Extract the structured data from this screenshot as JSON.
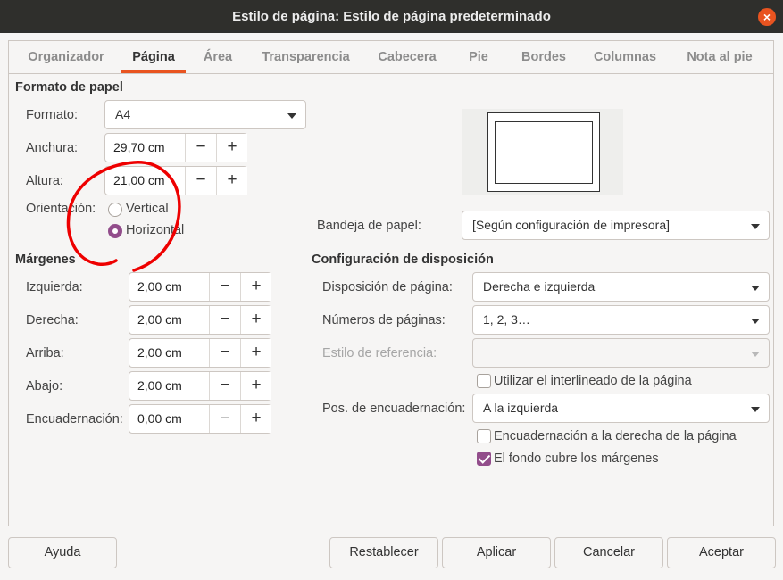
{
  "window": {
    "title": "Estilo de página: Estilo de página predeterminado",
    "close_icon": "×"
  },
  "tabs": [
    {
      "label": "Organizador"
    },
    {
      "label": "Página"
    },
    {
      "label": "Área"
    },
    {
      "label": "Transparencia"
    },
    {
      "label": "Cabecera"
    },
    {
      "label": "Pie"
    },
    {
      "label": "Bordes"
    },
    {
      "label": "Columnas"
    },
    {
      "label": "Nota al pie"
    }
  ],
  "active_tab": "Página",
  "paper_format": {
    "title": "Formato de papel",
    "format_label": "Formato:",
    "format_value": "A4",
    "width_label": "Anchura:",
    "width_value": "29,70 cm",
    "height_label": "Altura:",
    "height_value": "21,00 cm",
    "orientation_label": "Orientación:",
    "orientation_options": [
      "Vertical",
      "Horizontal"
    ],
    "orientation_selected": "Horizontal"
  },
  "paper_tray": {
    "label": "Bandeja de papel:",
    "value": "[Según configuración de impresora]"
  },
  "margins": {
    "title": "Márgenes",
    "left_label": "Izquierda:",
    "left_value": "2,00 cm",
    "right_label": "Derecha:",
    "right_value": "2,00 cm",
    "top_label": "Arriba:",
    "top_value": "2,00 cm",
    "bottom_label": "Abajo:",
    "bottom_value": "2,00 cm",
    "gutter_label": "Encuadernación:",
    "gutter_value": "0,00 cm"
  },
  "layout": {
    "title": "Configuración de disposición",
    "page_layout_label": "Disposición de página:",
    "page_layout_value": "Derecha e izquierda",
    "page_numbers_label": "Números de páginas:",
    "page_numbers_value": "1, 2, 3…",
    "ref_style_label": "Estilo de referencia:",
    "ref_style_value": "",
    "use_spacing_label": "Utilizar el interlineado de la página",
    "use_spacing_checked": false,
    "gutter_pos_label": "Pos. de encuadernación:",
    "gutter_pos_value": "A la izquierda",
    "gutter_right_label": "Encuadernación a la derecha de la página",
    "gutter_right_checked": false,
    "bg_covers_label": "El fondo cubre los márgenes",
    "bg_covers_checked": true
  },
  "spin": {
    "minus": "−",
    "plus": "+"
  },
  "buttons": {
    "help": "Ayuda",
    "reset": "Restablecer",
    "apply": "Aplicar",
    "cancel": "Cancelar",
    "ok": "Aceptar"
  },
  "colors": {
    "accent": "#e95420",
    "checked": "#924d8b",
    "annotation": "#ee0000",
    "titlebar": "#2f2f2c"
  }
}
